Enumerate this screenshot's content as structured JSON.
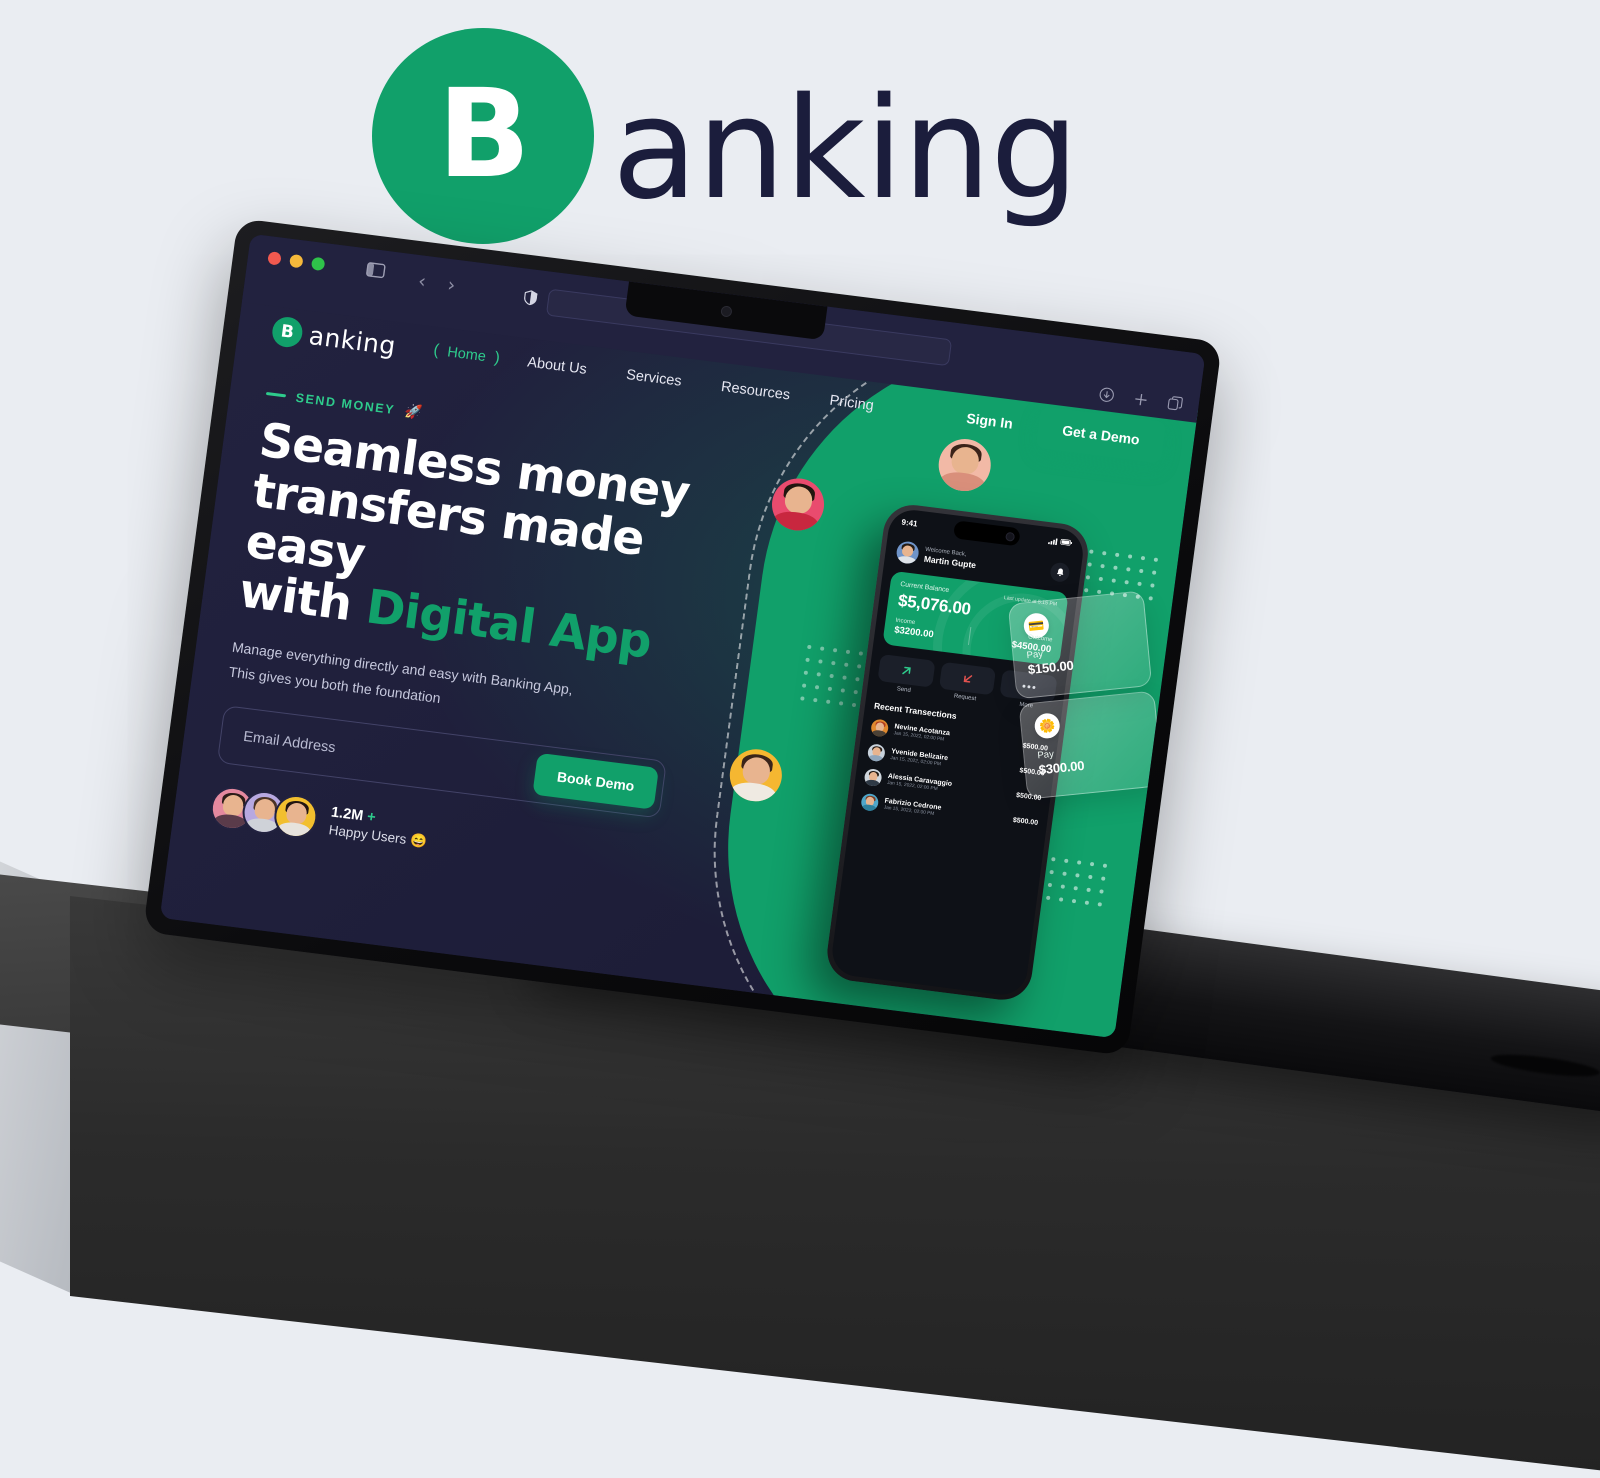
{
  "brand": {
    "mark_letter": "B",
    "wordmark": "anking",
    "green": "#11a06a",
    "navy": "#1b1d3c"
  },
  "browser": {
    "traffic_lights": [
      "close-red",
      "minimize-yellow",
      "maximize-green"
    ],
    "sidebar_toggle": "sidebar-icon",
    "back_arrow": "‹",
    "forward_arrow": "›",
    "shield_icon": "shield-icon",
    "url_value": "",
    "url_placeholder": "",
    "reload_icon": "↻",
    "right_icons": [
      "download-icon",
      "new-tab-icon",
      "tab-overview-icon"
    ]
  },
  "site": {
    "logo_mark": "B",
    "logo_text": "anking",
    "nav": [
      {
        "label": "Home",
        "active": true
      },
      {
        "label": "About Us",
        "active": false
      },
      {
        "label": "Services",
        "active": false
      },
      {
        "label": "Resources",
        "active": false
      },
      {
        "label": "Pricing",
        "active": false
      }
    ],
    "signin_label": "Sign In",
    "get_demo_label": "Get a Demo"
  },
  "hero": {
    "eyebrow": "SEND MONEY",
    "eyebrow_emoji": "🚀",
    "title_line1": "Seamless money",
    "title_line2": "transfers made easy",
    "title_line3_plain": "with ",
    "title_line3_accent": "Digital App",
    "subtitle_line1": "Manage everything directly and easy with Banking App,",
    "subtitle_line2": "This gives you both the foundation",
    "email_placeholder": "Email Address",
    "email_value": "",
    "book_demo_label": "Book Demo",
    "social_count": "1.2M",
    "social_plus": "+",
    "social_label": "Happy Users",
    "social_emoji": "😄"
  },
  "phone": {
    "time": "9:41",
    "welcome_label": "Welcome Back,",
    "user_name": "Martin Gupte",
    "bell_icon": "bell-icon",
    "balance_label": "Current Balance",
    "balance_updated": "Last update at 5:15 PM",
    "balance_amount": "$5,076.00",
    "income_label": "Income",
    "income_value": "$3200.00",
    "outcome_label": "Outcome",
    "outcome_value": "$4500.00",
    "quick_actions": [
      {
        "label": "Send",
        "icon": "arrow-up-right-icon"
      },
      {
        "label": "Request",
        "icon": "arrow-down-left-icon"
      },
      {
        "label": "More",
        "icon": "ellipsis-icon"
      }
    ],
    "recent_title": "Recent Transections",
    "transactions": [
      {
        "name": "Nevine Acotanza",
        "date": "Jan 15, 2022, 02:00 PM",
        "amount": "$500.00"
      },
      {
        "name": "Yvenide Belizaire",
        "date": "Jan 15, 2022, 02:00 PM",
        "amount": "$500.00"
      },
      {
        "name": "Alessia Caravaggio",
        "date": "Jan 15, 2022, 02:00 PM",
        "amount": "$500.00"
      },
      {
        "name": "Fabrizio Cedrone",
        "date": "Jan 15, 2022, 02:00 PM",
        "amount": "$500.00"
      }
    ]
  },
  "pay_cards": [
    {
      "icon": "wallet-icon",
      "label": "Pay",
      "amount": "$150.00"
    },
    {
      "icon": "flower-icon",
      "label": "Pay",
      "amount": "$300.00"
    }
  ]
}
